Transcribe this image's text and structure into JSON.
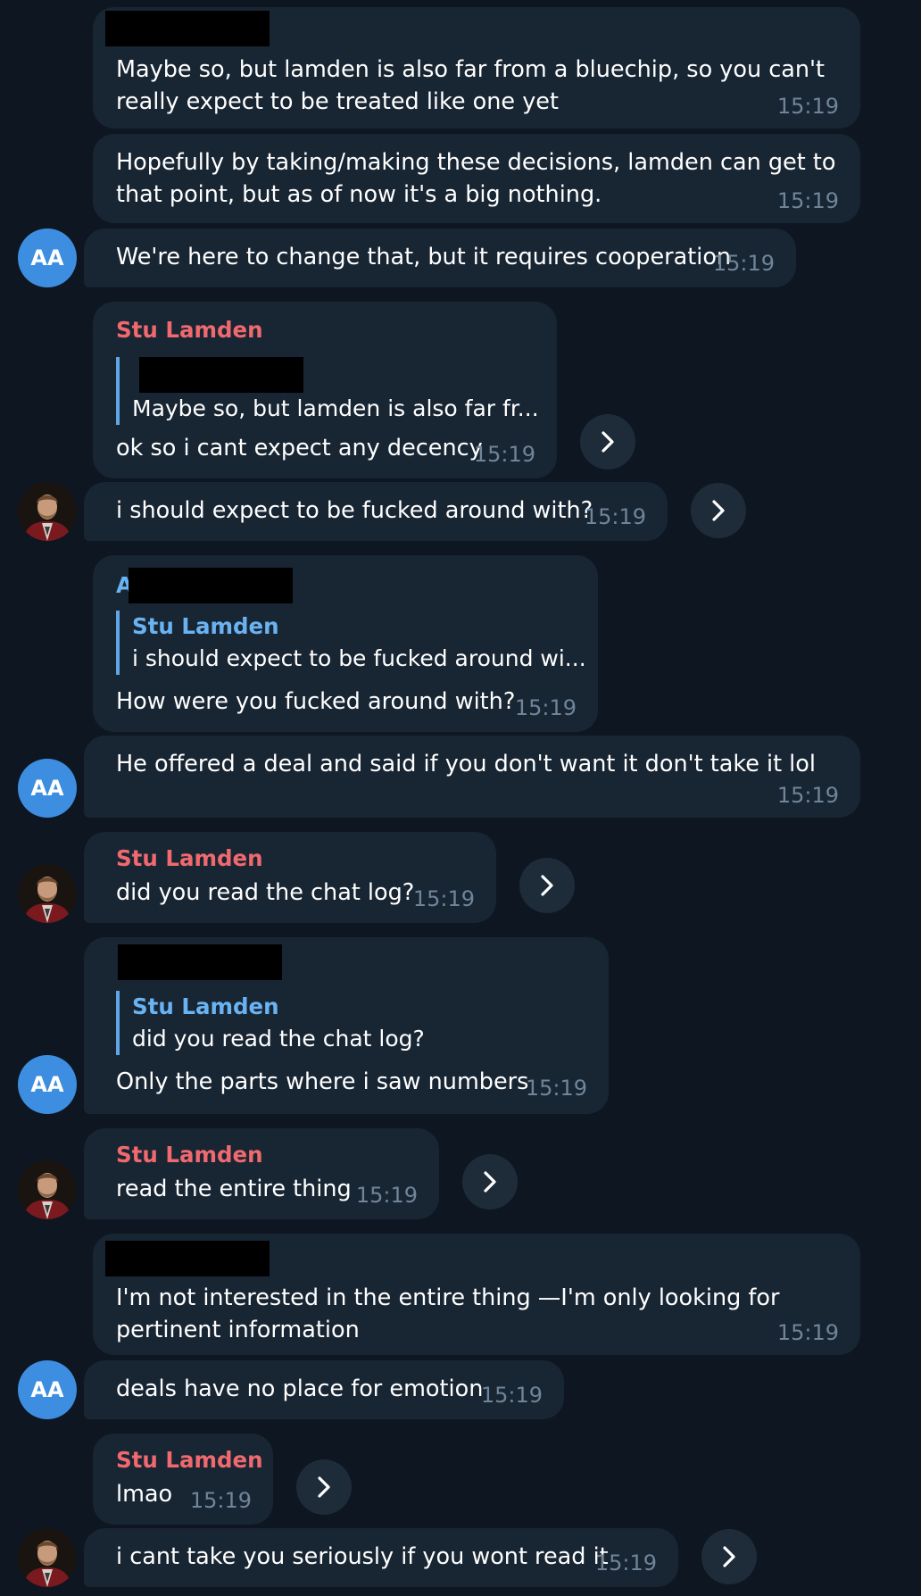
{
  "theme": {
    "background": "#0e1621",
    "bubble": "#182533",
    "sender_color": "#f0696e",
    "reply_name_color": "#6ab3f3",
    "avatar_color": "#3d8ee0",
    "time_color": "#6f8599"
  },
  "avatars": {
    "aa_initials": "AA"
  },
  "messages": {
    "m1": {
      "line1": "Maybe so, but lamden is also far from a bluechip, so you can't",
      "line2": "really expect to be treated like one yet",
      "time": "15:19"
    },
    "m2": {
      "line1": "Hopefully by taking/making these decisions, lamden can get to",
      "line2": "that point, but as of now it's a big nothing.",
      "time": "15:19"
    },
    "m3": {
      "text": "We're here to change that, but it requires cooperation",
      "time": "15:19"
    },
    "m4": {
      "sender": "Stu Lamden",
      "reply_text": "Maybe so, but lamden is also far fr...",
      "text": "ok so i cant expect any decency",
      "time": "15:19"
    },
    "m5": {
      "text": "i should expect to be fucked around with?",
      "time": "15:19"
    },
    "m6": {
      "sender_visible": "A",
      "reply_name": "Stu Lamden",
      "reply_text": "i should expect to be fucked around wi...",
      "text": "How were you fucked around with?",
      "time": "15:19"
    },
    "m7": {
      "text": "He offered a deal and said if you don't want it don't take it lol",
      "time": "15:19"
    },
    "m8": {
      "sender": "Stu Lamden",
      "text": "did you read the chat log?",
      "time": "15:19"
    },
    "m9": {
      "reply_name": "Stu Lamden",
      "reply_text": "did you read the chat log?",
      "text": "Only the parts where i saw numbers",
      "time": "15:19"
    },
    "m10": {
      "sender": "Stu Lamden",
      "text": "read the entire thing",
      "time": "15:19"
    },
    "m11": {
      "line1": "I'm not interested in the entire thing —I'm only looking for",
      "line2": "pertinent information",
      "time": "15:19"
    },
    "m12": {
      "text": "deals have no place for emotion",
      "time": "15:19"
    },
    "m13": {
      "sender": "Stu Lamden",
      "text": "lmao",
      "time": "15:19"
    },
    "m14": {
      "text": "i cant take you seriously if you wont read it",
      "time": "15:19"
    }
  }
}
